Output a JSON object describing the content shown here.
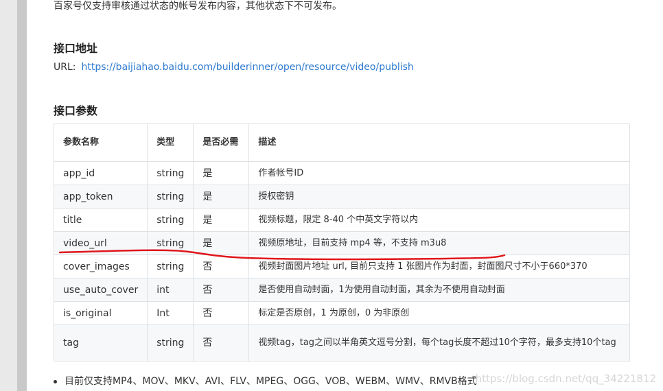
{
  "intro": "百家号仅支持审核通过状态的帐号发布内容，其他状态下不可发布。",
  "address_heading": "接口地址",
  "url_label": "URL:",
  "url": "https://baijiahao.baidu.com/builderinner/open/resource/video/publish",
  "params_heading": "接口参数",
  "table": {
    "headers": [
      "参数名称",
      "类型",
      "是否必需",
      "描述"
    ],
    "rows": [
      [
        "app_id",
        "string",
        "是",
        "作者帐号ID"
      ],
      [
        "app_token",
        "string",
        "是",
        "授权密钥"
      ],
      [
        "title",
        "string",
        "是",
        "视频标题，限定 8-40 个中英文字符以内"
      ],
      [
        "video_url",
        "string",
        "是",
        "视频原地址，目前支持 mp4 等，不支持 m3u8"
      ],
      [
        "cover_images",
        "string",
        "否",
        "视频封面图片地址 url, 目前只支持 1 张图片作为封面，封面图尺寸不小于660*370"
      ],
      [
        "use_auto_cover",
        "int",
        "否",
        "是否使用自动封面，1为使用自动封面，其余为不使用自动封面"
      ],
      [
        "is_original",
        "Int",
        "否",
        "标定是否原创，1 为原创，0 为非原创"
      ],
      [
        "tag",
        "string",
        "否",
        "视频tag，tag之间以半角英文逗号分割，每个tag长度不超过10个字符，最多支持10个tag"
      ]
    ]
  },
  "bullet": "目前仅支持MP4、MOV、MKV、AVI、FLV、MPEG、OGG、VOB、WEBM、WMV、RMVB格式",
  "watermark": "https://blog.csdn.net/qq_34221812",
  "colors": {
    "link": "#2d7ad1",
    "annotation": "#e0161b"
  }
}
